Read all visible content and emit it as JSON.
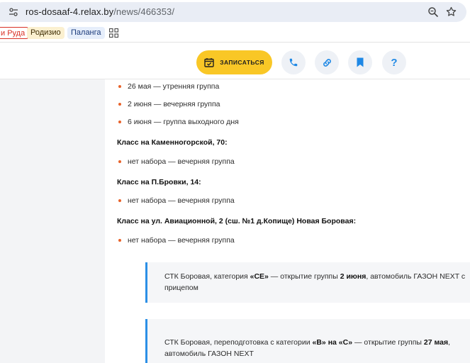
{
  "browser": {
    "url_host": "ros-dosaaf-4.relax.by",
    "url_path": "/news/466353/",
    "icons": {
      "site_info": "tune-icon",
      "zoom": "zoom-icon",
      "bookmark_star": "star-icon"
    }
  },
  "bookmarks_bar": {
    "items": [
      {
        "label": "и Руда",
        "color": "#d93025"
      },
      {
        "label": "Родизио",
        "color": "#fbf0d0"
      },
      {
        "label": "Паланга",
        "color": "#e6eefb"
      }
    ],
    "apps_icon": "apps-grid-icon"
  },
  "site_header": {
    "enroll_label": "ЗАПИСАТЬСЯ",
    "enroll_color": "#f9c726",
    "icons": [
      "phone-icon",
      "link-icon",
      "bookmark-icon",
      "help-icon"
    ],
    "help_glyph": "?",
    "accent_color": "#1e88e5"
  },
  "content": {
    "list_a": [
      "26 мая — утренняя группа",
      "2 июня — вечерняя группа",
      "6 июня — группа выходного дня"
    ],
    "heading_1": "Класс на Каменногорской, 70:",
    "list_b": [
      "нет набора — вечерняя группа"
    ],
    "heading_2": "Класс на П.Бровки, 14:",
    "list_c": [
      "нет набора — вечерняя группа"
    ],
    "heading_3": "Класс на ул. Авиационной, 2 (сш. №1 д.Копище) Новая Боровая:",
    "list_d": [
      "нет набора — вечерняя группа"
    ],
    "note_1": {
      "p1": "СТК Боровая, категория ",
      "b1": "«CE»",
      "p2": " — открытие группы ",
      "b2": "2 июня",
      "p3": ", автомобиль ГАЗОН NEXT с прицепом"
    },
    "note_2": {
      "p1": "СТК Боровая, переподготовка с категории ",
      "b1": "«B»",
      "p2": " ",
      "b2": "на",
      "p3": " ",
      "b3": "«C»",
      "p4": " — открытие группы ",
      "b4": "27 мая",
      "p5": ", автомобиль ГАЗОН NEXT"
    },
    "bullet_color": "#e8632b",
    "note_border_color": "#2b8fe6"
  }
}
